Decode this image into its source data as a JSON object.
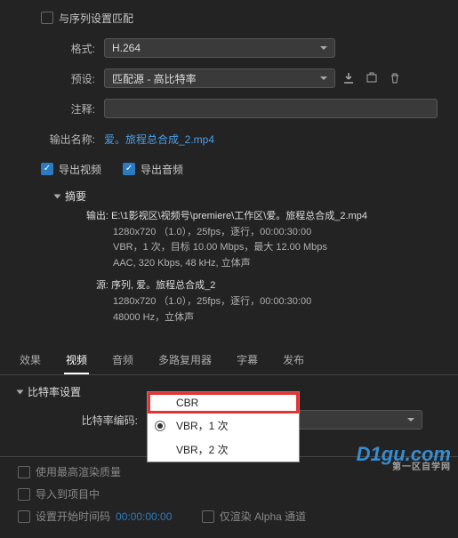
{
  "top": {
    "match_sequence_label": "与序列设置匹配",
    "format_label": "格式:",
    "format_value": "H.264",
    "preset_label": "预设:",
    "preset_value": "匹配源 - 高比特率",
    "comment_label": "注释:",
    "comment_value": "",
    "output_name_label": "输出名称:",
    "output_name_value": "爱。旅程总合成_2.mp4",
    "export_video_label": "导出视频",
    "export_audio_label": "导出音频"
  },
  "summary": {
    "title": "摘要",
    "output_label": "输出:",
    "output_path": "E:\\1影视区\\视频号\\premiere\\工作区\\爱。旅程总合成_2.mp4",
    "output_l2": "1280x720 （1.0），25fps，逐行，00:00:30:00",
    "output_l3": "VBR，1 次，目标 10.00 Mbps，最大 12.00 Mbps",
    "output_l4": "AAC, 320 Kbps, 48 kHz, 立体声",
    "source_label": "源:",
    "source_name": "序列, 爱。旅程总合成_2",
    "source_l2": "1280x720 （1.0），25fps，逐行，00:00:30:00",
    "source_l3": "48000 Hz，立体声"
  },
  "tabs": {
    "effects": "效果",
    "video": "视频",
    "audio": "音频",
    "mux": "多路复用器",
    "captions": "字幕",
    "publish": "发布"
  },
  "bitrate": {
    "section_title": "比特率设置",
    "encoding_label": "比特率编码:",
    "encoding_value": "VBR，1 次",
    "options": {
      "cbr": "CBR",
      "vbr1": "VBR，1 次",
      "vbr2": "VBR，2 次"
    }
  },
  "bottom": {
    "max_quality": "使用最高渲染质量",
    "import_project": "导入到项目中",
    "start_timecode": "设置开始时间码",
    "start_timecode_value": "00:00:00:00",
    "render_alpha": "仅渲染 Alpha 通道"
  },
  "watermark": {
    "brand": "D1gu.com",
    "sub": "第一区自学网"
  }
}
